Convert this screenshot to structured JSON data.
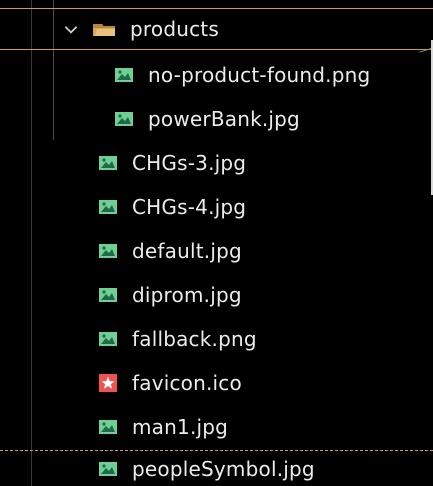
{
  "explorer": {
    "folder": {
      "name": "products",
      "expanded": true
    },
    "children": [
      {
        "name": "no-product-found.png",
        "icon": "image-icon"
      },
      {
        "name": "powerBank.jpg",
        "icon": "image-icon"
      }
    ],
    "files": [
      {
        "name": "CHGs-3.jpg",
        "icon": "image-icon"
      },
      {
        "name": "CHGs-4.jpg",
        "icon": "image-icon"
      },
      {
        "name": "default.jpg",
        "icon": "image-icon"
      },
      {
        "name": "diprom.jpg",
        "icon": "image-icon"
      },
      {
        "name": "fallback.png",
        "icon": "image-icon"
      },
      {
        "name": "favicon.ico",
        "icon": "favicon-icon"
      },
      {
        "name": "man1.jpg",
        "icon": "image-icon"
      },
      {
        "name": "peopleSymbol.jpg",
        "icon": "image-icon"
      }
    ]
  },
  "colors": {
    "image_icon": "#6fcf97",
    "favicon_icon": "#ef5350",
    "folder_icon": "#d8a85a",
    "highlight_border": "#d59a4a"
  }
}
